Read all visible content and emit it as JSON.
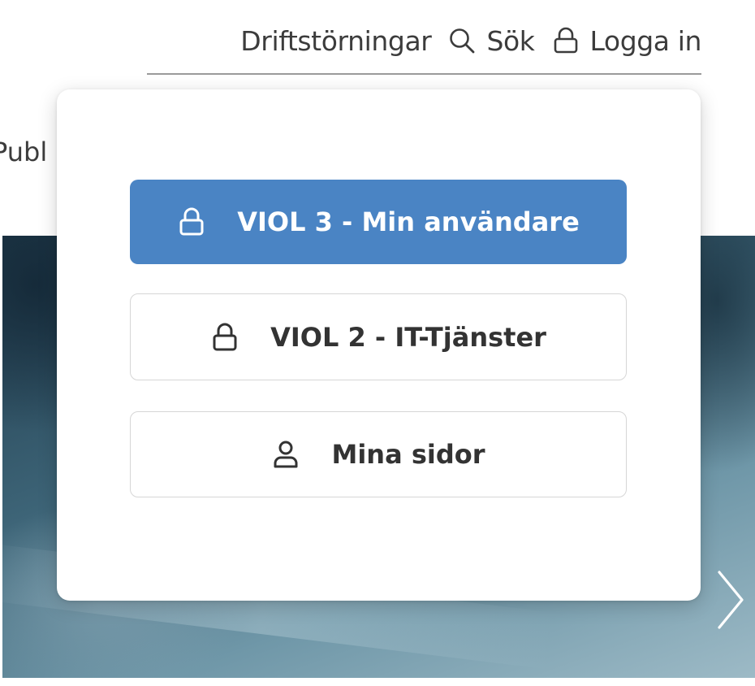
{
  "topnav": {
    "disruptions_label": "Driftstörningar",
    "search_label": "Sök",
    "login_label": "Logga in",
    "search_icon": "search-icon",
    "lock_icon": "lock-icon"
  },
  "background": {
    "peek_text": "Publ"
  },
  "login_menu": {
    "options": [
      {
        "label": "VIOL 3 - Min användare",
        "icon": "lock-icon",
        "style": "primary"
      },
      {
        "label": "VIOL 2 - IT-Tjänster",
        "icon": "lock-icon",
        "style": "secondary"
      },
      {
        "label": "Mina sidor",
        "icon": "user-icon",
        "style": "secondary"
      }
    ]
  },
  "hero": {
    "next_icon": "chevron-right-icon"
  },
  "colors": {
    "primary_button": "#4a84c4",
    "text": "#333333",
    "divider": "#9a9a9a"
  }
}
